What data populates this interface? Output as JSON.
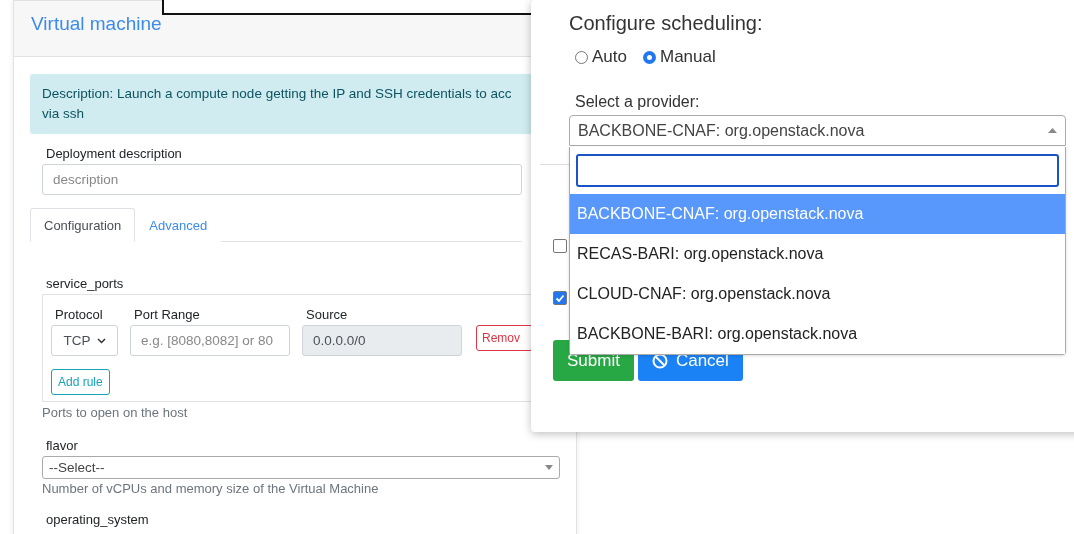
{
  "form": {
    "title": "Virtual machine",
    "alert_lines": [
      "Description: Launch a compute node getting the IP and SSH credentials to acc",
      "via ssh"
    ],
    "deployment": {
      "label": "Deployment description",
      "placeholder": "description"
    },
    "tabs": [
      {
        "label": "Configuration",
        "selected": true
      },
      {
        "label": "Advanced",
        "selected": false
      }
    ],
    "service_ports": {
      "label": "service_ports",
      "columns": [
        "Protocol",
        "Port Range",
        "Source"
      ],
      "protocol": "TCP",
      "port_placeholder": "e.g. [8080,8082] or 80",
      "source": "0.0.0.0/0",
      "remove": "Remov",
      "add": "Add rule",
      "help": "Ports to open on the host"
    },
    "flavor": {
      "label": "flavor",
      "value": "--Select--",
      "help": "Number of vCPUs and memory size of the Virtual Machine"
    },
    "operating_system": {
      "label": "operating_system"
    }
  },
  "scheduling": {
    "title": "Configure scheduling:",
    "modes": [
      {
        "label": "Auto",
        "selected": false
      },
      {
        "label": "Manual",
        "selected": true
      }
    ],
    "provider_label": "Select a provider:",
    "provider_value": "BACKBONE-CNAF: org.openstack.nova",
    "options": [
      {
        "label": "BACKBONE-CNAF: org.openstack.nova",
        "selected": true
      },
      {
        "label": "RECAS-BARI: org.openstack.nova",
        "selected": false
      },
      {
        "label": "CLOUD-CNAF: org.openstack.nova",
        "selected": false
      },
      {
        "label": "BACKBONE-BARI: org.openstack.nova",
        "selected": false
      }
    ],
    "checkboxes": [
      {
        "checked": false
      },
      {
        "checked": true
      }
    ],
    "buttons": [
      {
        "label": "Submit",
        "kind": "submit"
      },
      {
        "label": "Cancel",
        "kind": "cancel"
      }
    ]
  }
}
